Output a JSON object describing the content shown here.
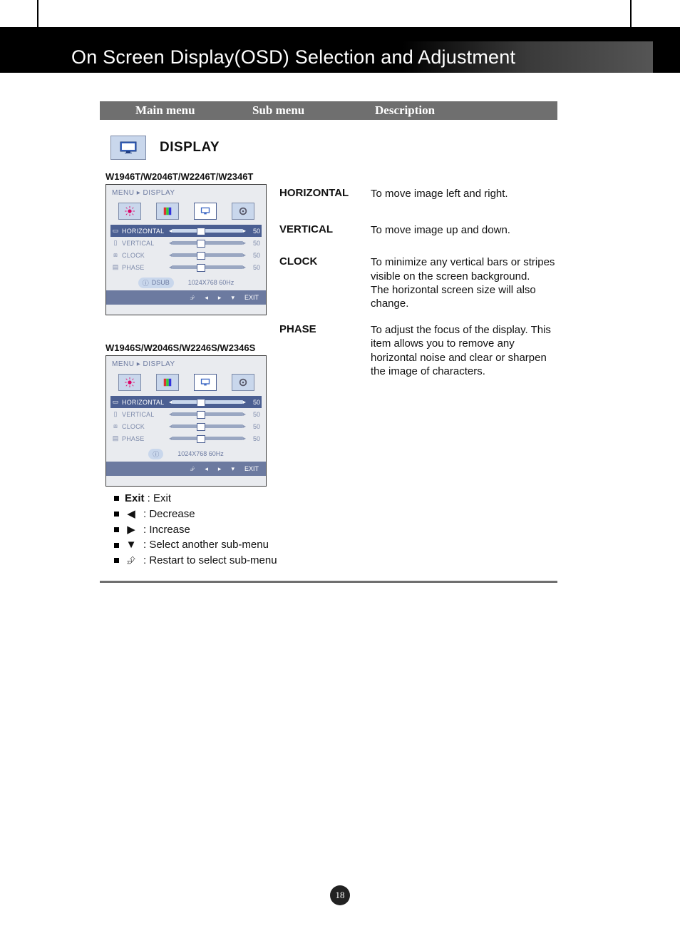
{
  "header": {
    "title": "On Screen Display(OSD) Selection and Adjustment"
  },
  "columns": {
    "main_menu": "Main menu",
    "sub_menu": "Sub menu",
    "description": "Description"
  },
  "display": {
    "title": "DISPLAY",
    "model_t": "W1946T/W2046T/W2246T/W2346T",
    "model_s": "W1946S/W2046S/W2246S/W2346S"
  },
  "osd": {
    "breadcrumb_menu": "MENU",
    "breadcrumb_sep": "▸",
    "breadcrumb_page": "DISPLAY",
    "rows": [
      {
        "label": "HORIZONTAL",
        "value": "50"
      },
      {
        "label": "VERTICAL",
        "value": "50"
      },
      {
        "label": "CLOCK",
        "value": "50"
      },
      {
        "label": "PHASE",
        "value": "50"
      }
    ],
    "dsub_label": "DSUB",
    "resolution": "1024X768  60Hz",
    "exit_label": "EXIT"
  },
  "descriptions": [
    {
      "head": "HORIZONTAL",
      "text": "To move image left and right."
    },
    {
      "head": "VERTICAL",
      "text": "To move image up and down."
    },
    {
      "head": "CLOCK",
      "text": "To minimize any vertical bars or stripes visible on the screen background.\nThe horizontal screen size will also change."
    },
    {
      "head": "PHASE",
      "text": "To adjust the focus of the display. This item allows you to remove any horizontal noise and clear or sharpen the image of characters."
    }
  ],
  "legend": {
    "exit_label": "Exit",
    "exit_desc": " : Exit",
    "decrease": " : Decrease",
    "increase": " : Increase",
    "select": " : Select another sub-menu",
    "restart": " : Restart to select sub-menu"
  },
  "page_number": "18"
}
